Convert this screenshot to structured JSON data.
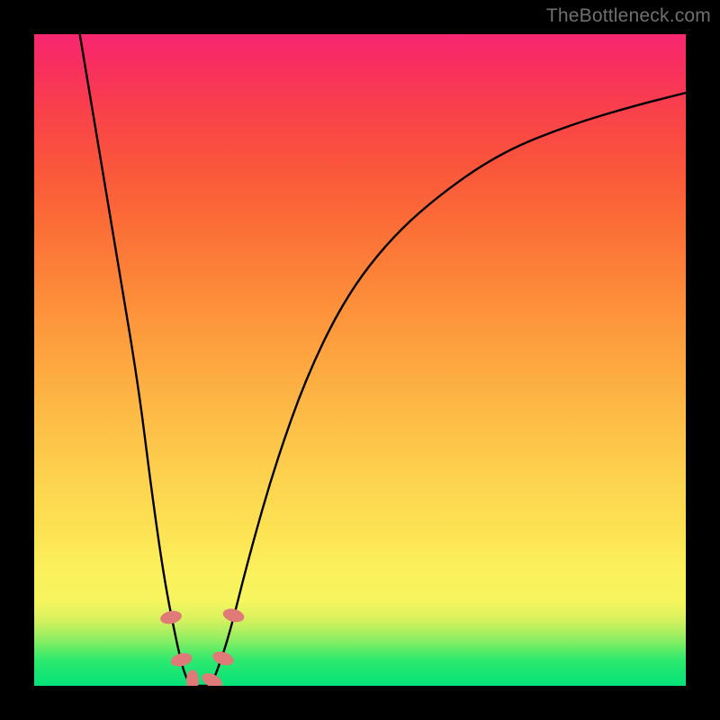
{
  "watermark": "TheBottleneck.com",
  "chart_data": {
    "type": "line",
    "title": "",
    "xlabel": "",
    "ylabel": "",
    "x_range": [
      0,
      100
    ],
    "y_range": [
      0,
      100
    ],
    "series": [
      {
        "name": "bottleneck-curve",
        "x": [
          7,
          10,
          13,
          16,
          18,
          20,
          22,
          23,
          24,
          25,
          26,
          27,
          28,
          30,
          33,
          37,
          42,
          48,
          55,
          63,
          72,
          82,
          92,
          100
        ],
        "y": [
          100,
          82,
          64,
          46,
          30,
          16,
          6,
          2,
          0,
          0,
          0,
          0,
          2,
          8,
          20,
          34,
          48,
          60,
          69,
          76,
          82,
          86,
          89,
          91
        ]
      }
    ],
    "markers": [
      {
        "name": "marker-left-upper",
        "x": 21.0,
        "y": 10.5
      },
      {
        "name": "marker-left-lower",
        "x": 22.6,
        "y": 4.0
      },
      {
        "name": "marker-bottom-left",
        "x": 24.3,
        "y": 0.8
      },
      {
        "name": "marker-bottom-right",
        "x": 27.3,
        "y": 0.8
      },
      {
        "name": "marker-right-lower",
        "x": 29.0,
        "y": 4.2
      },
      {
        "name": "marker-right-upper",
        "x": 30.6,
        "y": 10.8
      }
    ],
    "marker_style": {
      "color": "#e07a78",
      "rx": 7,
      "ry": 12,
      "rotation_follow_curve": true
    },
    "background_gradient": {
      "orientation": "vertical",
      "stops": [
        {
          "pos": 0.0,
          "color": "#05e27a"
        },
        {
          "pos": 0.13,
          "color": "#f6f55e"
        },
        {
          "pos": 0.56,
          "color": "#fc8038"
        },
        {
          "pos": 1.0,
          "color": "#f82772"
        }
      ]
    }
  }
}
